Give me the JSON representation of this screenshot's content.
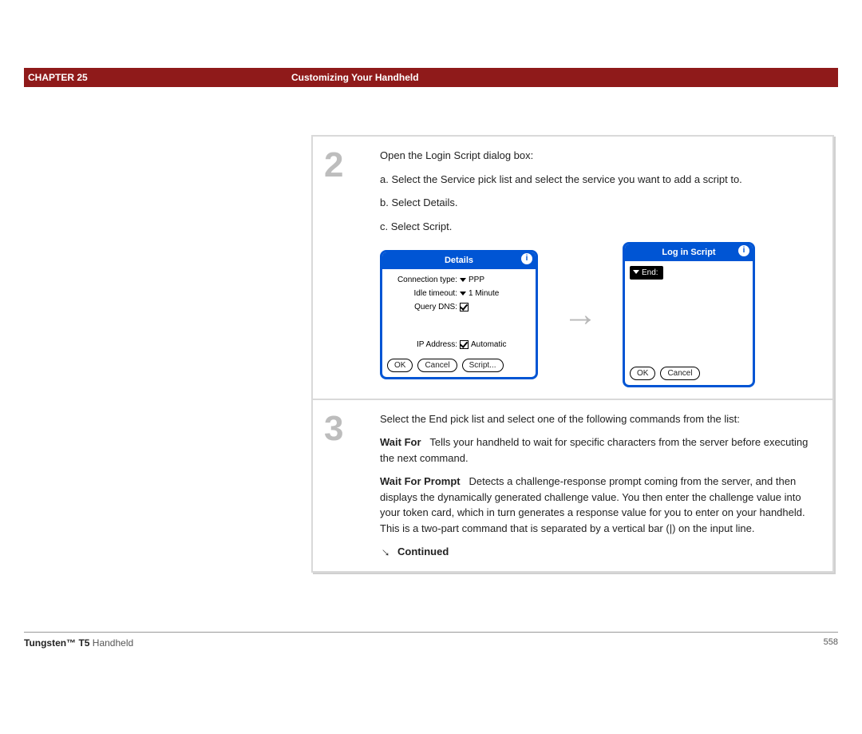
{
  "header": {
    "chapter": "CHAPTER 25",
    "title": "Customizing Your Handheld"
  },
  "steps": {
    "s2": {
      "num": "2",
      "intro": "Open the Login Script dialog box:",
      "a": "a.  Select the Service pick list and select the service you want to add a script to.",
      "b": "b.  Select Details.",
      "c": "c.  Select Script."
    },
    "s3": {
      "num": "3",
      "intro": "Select the End pick list and select one of the following commands from the list:",
      "wait_for_k": "Wait For",
      "wait_for_t": "Tells your handheld to wait for specific characters from the server before executing the next command.",
      "wfp_k": "Wait For Prompt",
      "wfp_t": "Detects a challenge-response prompt coming from the server, and then displays the dynamically generated challenge value. You then enter the challenge value into your token card, which in turn generates a response value for you to enter on your handheld. This is a two-part command that is separated by a vertical bar (|) on the input line.",
      "continued": "Continued"
    }
  },
  "dialogs": {
    "details": {
      "title": "Details",
      "conn_lbl": "Connection type:",
      "conn_val": "PPP",
      "idle_lbl": "Idle timeout:",
      "idle_val": "1 Minute",
      "dns_lbl": "Query DNS:",
      "ip_lbl": "IP Address:",
      "ip_val": "Automatic",
      "ok": "OK",
      "cancel": "Cancel",
      "script": "Script..."
    },
    "login": {
      "title": "Log in Script",
      "end": "End:",
      "ok": "OK",
      "cancel": "Cancel"
    }
  },
  "footer": {
    "product_bold": "Tungsten™ T5",
    "product_rest": "Handheld",
    "page": "558"
  }
}
